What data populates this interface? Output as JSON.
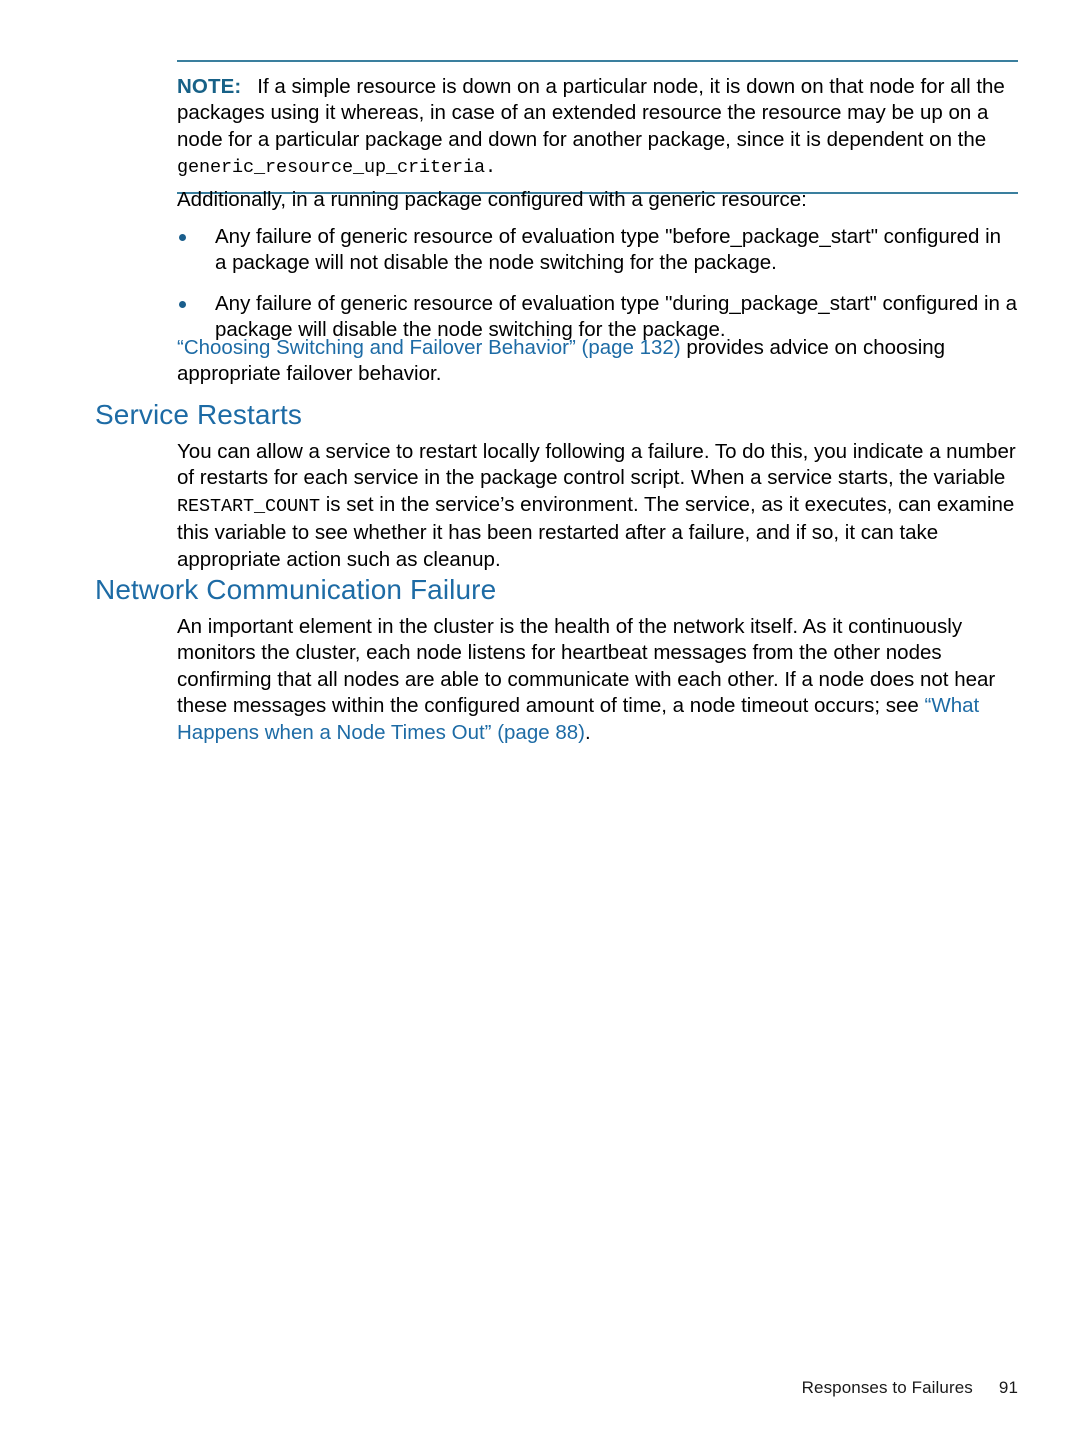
{
  "document": {
    "page_number": "91",
    "footer_title": "Responses to Failures"
  },
  "note": {
    "label": "NOTE:",
    "text_line": "If a simple resource is down on a particular node, it is down on that node for all the packages using it whereas, in case of an extended resource the resource may be up on a node for a particular package and down for another package, since it is dependent on the",
    "code_term": "generic_resource_up_criteria."
  },
  "intro": {
    "text": "Additionally, in a running package configured with a generic resource:"
  },
  "bullets": [
    {
      "text": "Any failure of generic resource of evaluation type \"before_package_start\" configured in a package will not disable the node switching for the package."
    },
    {
      "text": "Any failure of generic resource of evaluation type \"during_package_start\" configured in a package will disable the node switching for the package."
    }
  ],
  "crossref_paragraph": {
    "link_text": "“Choosing Switching and Failover Behavior” (page 132)",
    "tail_text": " provides advice on choosing appropriate failover behavior."
  },
  "service_restarts": {
    "heading": "Service Restarts",
    "para_part1": "You can allow a service to restart locally following a failure. To do this, you indicate a number of restarts for each service in the package control script. When a service starts, the variable ",
    "code_term": "RESTART_COUNT",
    "para_part2": " is set in the service’s environment. The service, as it executes, can examine this variable to see whether it has been restarted after a failure, and if so, it can take appropriate action such as cleanup."
  },
  "network_failure": {
    "heading": "Network Communication Failure",
    "para_part1": "An important element in the cluster is the health of the network itself. As it continuously monitors the cluster, each node listens for heartbeat messages from the other nodes confirming that all nodes are able to communicate with each other. If a node does not hear these messages within the configured amount of time, a node timeout occurs; see ",
    "link_text": "“What Happens when a Node Times Out” (page 88)",
    "para_part2": "."
  },
  "colors": {
    "heading_blue": "#1d6ba5",
    "note_label_blue": "#176187",
    "rule_blue": "#3a7f9e",
    "bullet_blue": "#1a5e8c",
    "link_blue": "#1d6ba5"
  }
}
